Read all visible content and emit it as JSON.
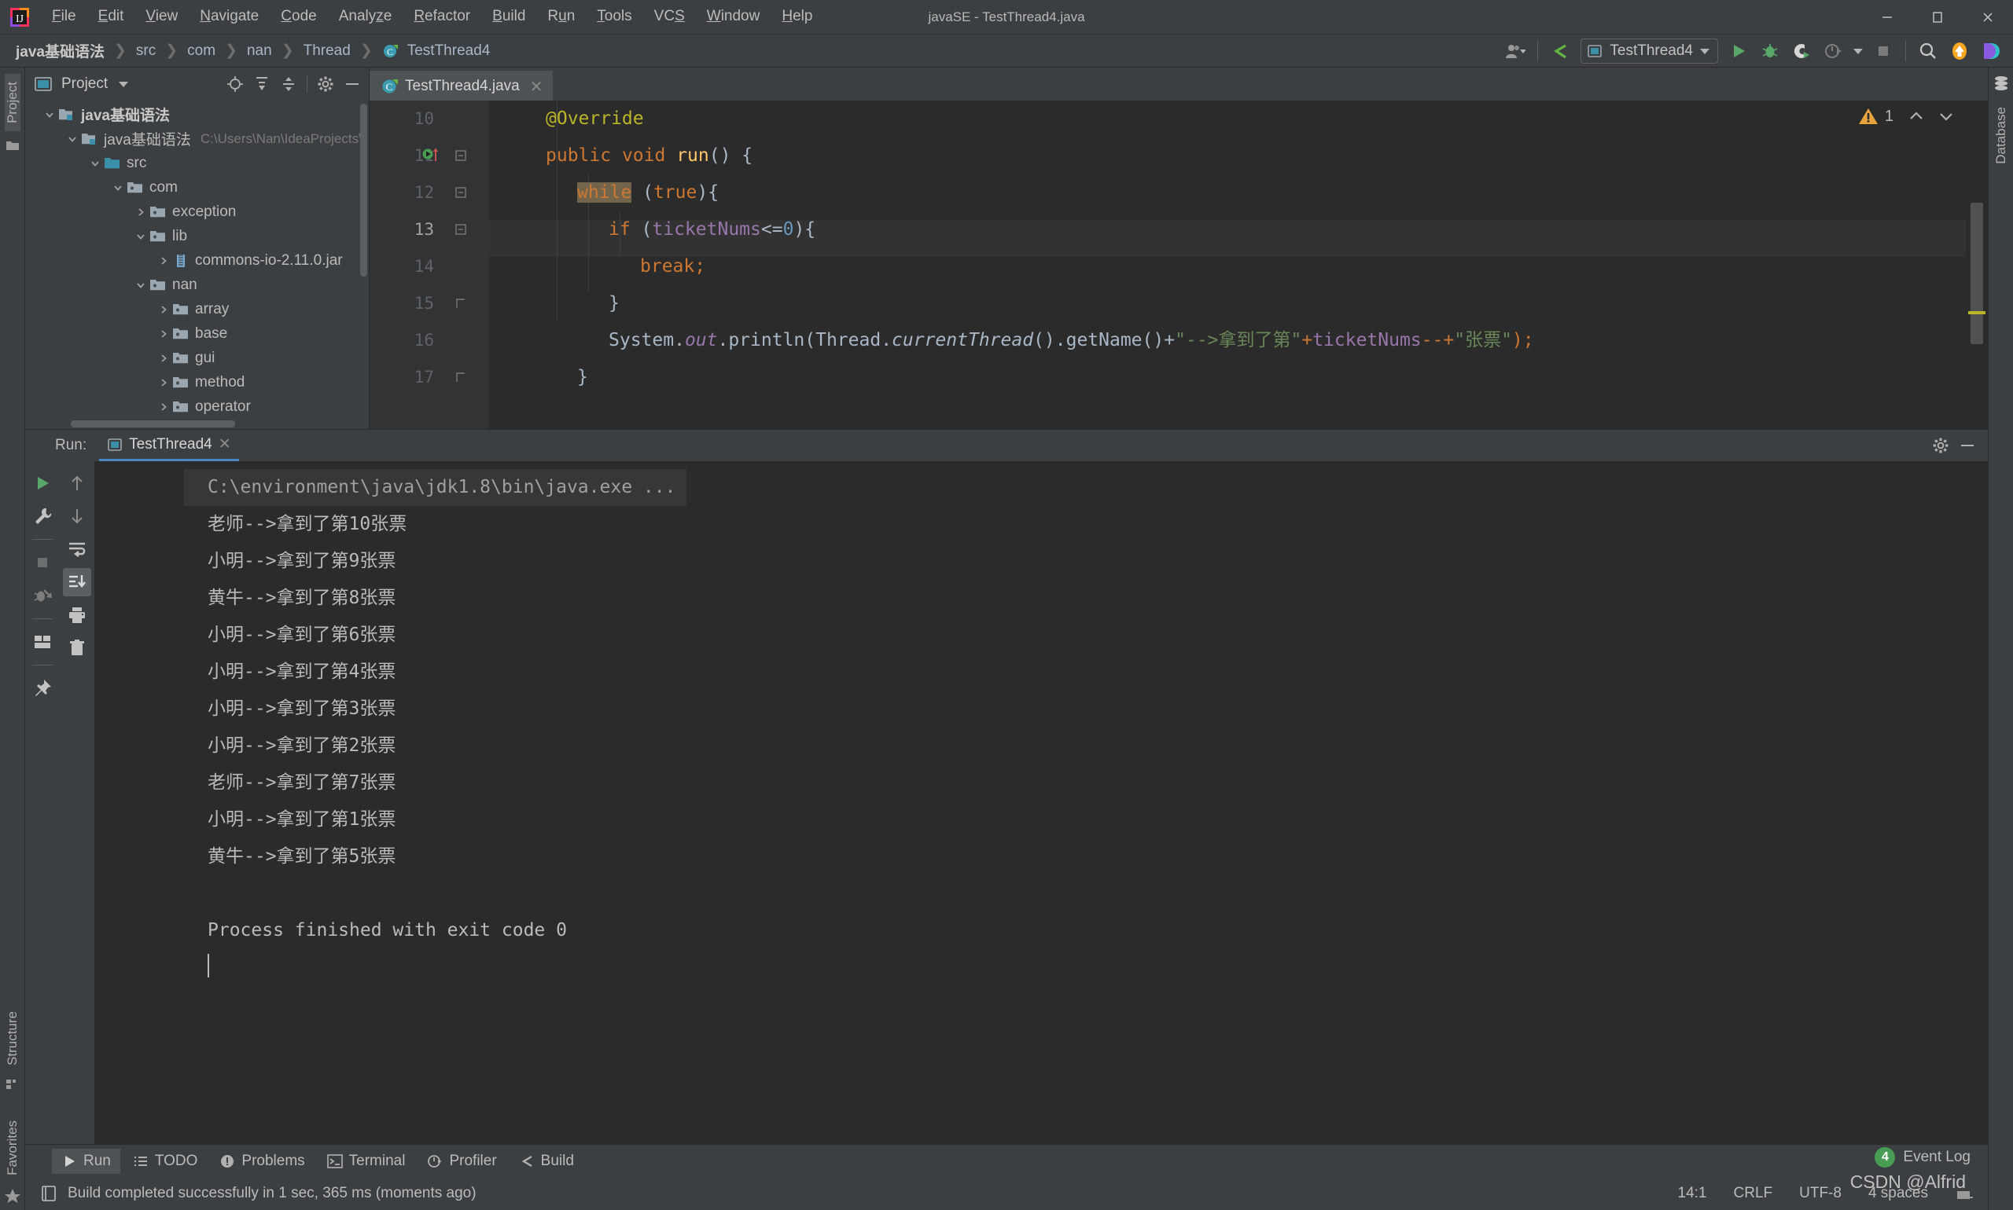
{
  "window": {
    "title": "javaSE - TestThread4.java",
    "minimize": "–",
    "maximize": "❐",
    "close": "✕"
  },
  "menu": [
    {
      "label": "File",
      "mnemonic": "F"
    },
    {
      "label": "Edit",
      "mnemonic": "E"
    },
    {
      "label": "View",
      "mnemonic": "V"
    },
    {
      "label": "Navigate",
      "mnemonic": "N"
    },
    {
      "label": "Code",
      "mnemonic": "C"
    },
    {
      "label": "Analyze",
      "mnemonic": "z"
    },
    {
      "label": "Refactor",
      "mnemonic": "R"
    },
    {
      "label": "Build",
      "mnemonic": "B"
    },
    {
      "label": "Run",
      "mnemonic": "u"
    },
    {
      "label": "Tools",
      "mnemonic": "T"
    },
    {
      "label": "VCS",
      "mnemonic": "S"
    },
    {
      "label": "Window",
      "mnemonic": "W"
    },
    {
      "label": "Help",
      "mnemonic": "H"
    }
  ],
  "breadcrumb": [
    "java基础语法",
    "src",
    "com",
    "nan",
    "Thread",
    "TestThread4"
  ],
  "toolbar": {
    "run_config": "TestThread4",
    "icons": [
      "user-avatar-icon",
      "update-project-icon",
      "run-icon",
      "debug-icon",
      "run-coverage-icon",
      "profiler-icon",
      "stop-icon",
      "search-icon",
      "update-icon",
      "datalore-icon"
    ]
  },
  "project_panel": {
    "title": "Project",
    "tools": [
      "locate-icon",
      "expand-all-icon",
      "collapse-all-icon",
      "settings-gear-icon",
      "hide-icon"
    ],
    "tree": [
      {
        "label": "java基础语法",
        "indent": 0,
        "arrow": "down",
        "icon": "module-icon",
        "bold": true,
        "path": ""
      },
      {
        "label": "java基础语法",
        "indent": 1,
        "arrow": "down",
        "icon": "module-icon",
        "bold": false,
        "path": "C:\\Users\\Nan\\IdeaProjects\\"
      },
      {
        "label": "src",
        "indent": 2,
        "arrow": "down",
        "icon": "source-folder-icon",
        "bold": false,
        "path": ""
      },
      {
        "label": "com",
        "indent": 3,
        "arrow": "down",
        "icon": "package-icon",
        "bold": false,
        "path": ""
      },
      {
        "label": "exception",
        "indent": 4,
        "arrow": "right",
        "icon": "package-icon",
        "bold": false,
        "path": ""
      },
      {
        "label": "lib",
        "indent": 4,
        "arrow": "down",
        "icon": "package-icon",
        "bold": false,
        "path": ""
      },
      {
        "label": "commons-io-2.11.0.jar",
        "indent": 5,
        "arrow": "right",
        "icon": "jar-icon",
        "bold": false,
        "path": ""
      },
      {
        "label": "nan",
        "indent": 4,
        "arrow": "down",
        "icon": "package-icon",
        "bold": false,
        "path": ""
      },
      {
        "label": "array",
        "indent": 5,
        "arrow": "right",
        "icon": "package-icon",
        "bold": false,
        "path": ""
      },
      {
        "label": "base",
        "indent": 5,
        "arrow": "right",
        "icon": "package-icon",
        "bold": false,
        "path": ""
      },
      {
        "label": "gui",
        "indent": 5,
        "arrow": "right",
        "icon": "package-icon",
        "bold": false,
        "path": ""
      },
      {
        "label": "method",
        "indent": 5,
        "arrow": "right",
        "icon": "package-icon",
        "bold": false,
        "path": ""
      },
      {
        "label": "operator",
        "indent": 5,
        "arrow": "right",
        "icon": "package-icon",
        "bold": false,
        "path": ""
      }
    ]
  },
  "editor": {
    "tab": "TestThread4.java",
    "tab_close": "✕",
    "warning_count": "1",
    "lines": [
      {
        "num": "10",
        "current": false
      },
      {
        "num": "11",
        "current": false
      },
      {
        "num": "12",
        "current": false
      },
      {
        "num": "13",
        "current": true
      },
      {
        "num": "14",
        "current": false
      },
      {
        "num": "15",
        "current": false
      },
      {
        "num": "16",
        "current": false
      },
      {
        "num": "17",
        "current": false
      }
    ],
    "code": {
      "l10": "@Override",
      "l11_a": "public",
      "l11_b": "void",
      "l11_c": "run",
      "l11_d": "() {",
      "l12_a": "while",
      "l12_b": " (",
      "l12_c": "true",
      "l12_d": "){",
      "l13_a": "if",
      "l13_b": " (",
      "l13_c": "ticketNums",
      "l13_d": "<=",
      "l13_e": "0",
      "l13_f": "){",
      "l14": "break;",
      "l15": "}",
      "l16_a": "System.",
      "l16_b": "out",
      "l16_c": ".println(Thread.",
      "l16_d": "currentThread",
      "l16_e": "().getName()+",
      "l16_f": "\"-->拿到了第\"",
      "l16_g": "+",
      "l16_h": "ticketNums",
      "l16_i": "--+",
      "l16_j": "\"张票\"",
      "l16_k": ");",
      "l17": "}"
    }
  },
  "run_window": {
    "label": "Run:",
    "tab": "TestThread4",
    "tab_close": "✕",
    "left_tools": [
      "rerun-icon",
      "edit-configurations-icon",
      "stop-icon",
      "stop-debug-icon",
      "layout-icon",
      "pin-icon"
    ],
    "right_tools": [
      "scroll-up-icon",
      "scroll-down-icon",
      "soft-wrap-icon",
      "scroll-to-end-icon",
      "print-icon",
      "clear-all-icon"
    ],
    "head_tools": [
      "settings-gear-icon",
      "hide-icon"
    ],
    "console": {
      "command": "C:\\environment\\java\\jdk1.8\\bin\\java.exe ...",
      "output": [
        "老师-->拿到了第10张票",
        "小明-->拿到了第9张票",
        "黄牛-->拿到了第8张票",
        "小明-->拿到了第6张票",
        "小明-->拿到了第4张票",
        "小明-->拿到了第3张票",
        "小明-->拿到了第2张票",
        "老师-->拿到了第7张票",
        "小明-->拿到了第1张票",
        "黄牛-->拿到了第5张票"
      ],
      "blank": "",
      "finished": "Process finished with exit code 0"
    }
  },
  "left_stripe": {
    "project_tab": "Project",
    "structure_tab": "Structure",
    "favorites_tab": "Favorites"
  },
  "right_stripe": {
    "database_tab": "Database"
  },
  "bottom_tabs": [
    {
      "label": "Run",
      "icon": "play-icon",
      "active": true
    },
    {
      "label": "TODO",
      "icon": "todo-icon",
      "active": false
    },
    {
      "label": "Problems",
      "icon": "problems-icon",
      "active": false
    },
    {
      "label": "Terminal",
      "icon": "terminal-icon",
      "active": false
    },
    {
      "label": "Profiler",
      "icon": "profiler-icon",
      "active": false
    },
    {
      "label": "Build",
      "icon": "build-icon",
      "active": false
    }
  ],
  "status_bar": {
    "message": "Build completed successfully in 1 sec, 365 ms (moments ago)",
    "caret": "14:1",
    "line_sep": "CRLF",
    "encoding": "UTF-8",
    "indent": "4 spaces",
    "event_log": "Event Log",
    "event_log_count": "4"
  },
  "watermark": "CSDN @Alfrid",
  "colors": {
    "accent_blue": "#4a88c7",
    "green": "#499c54",
    "warn_yellow": "#e8a33d",
    "keyword_orange": "#cc7832",
    "string_green": "#6a8759",
    "field_purple": "#9876aa",
    "number_blue": "#6897bb"
  }
}
